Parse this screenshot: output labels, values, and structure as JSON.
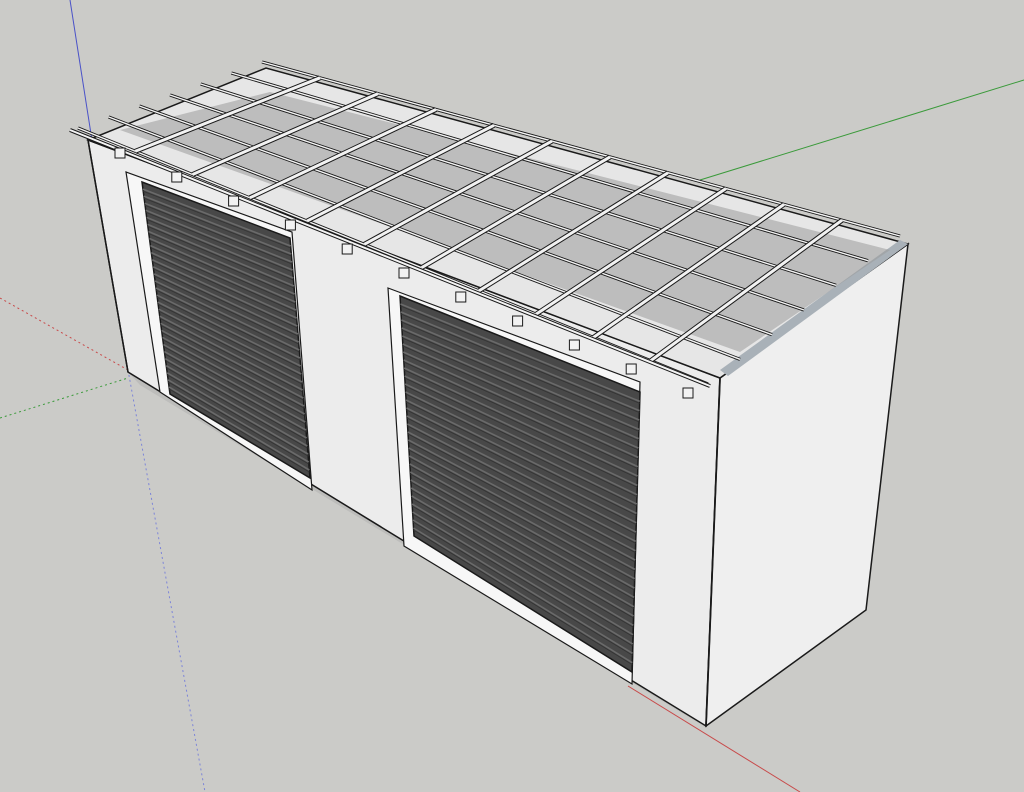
{
  "scene": {
    "background": "#cbcbc8",
    "wall_color": "#ebebeb",
    "side_wall_color": "#f0f0f0",
    "door_color": "#484848",
    "door_slat_color": "#6a6a6a",
    "edge_color": "#1a1a1a",
    "roof_shadow_color": "#9a9a9a",
    "axis_colors": {
      "x_axis": "#c84a4a",
      "y_axis": "#3a9a3a",
      "z_axis": "#4a52c8"
    },
    "objects": [
      {
        "name": "storage-building",
        "doors": 2,
        "roof_type": "pergola-frame"
      }
    ],
    "icons": {
      "axis": "model-axis-icon",
      "door": "roller-door-icon"
    }
  }
}
